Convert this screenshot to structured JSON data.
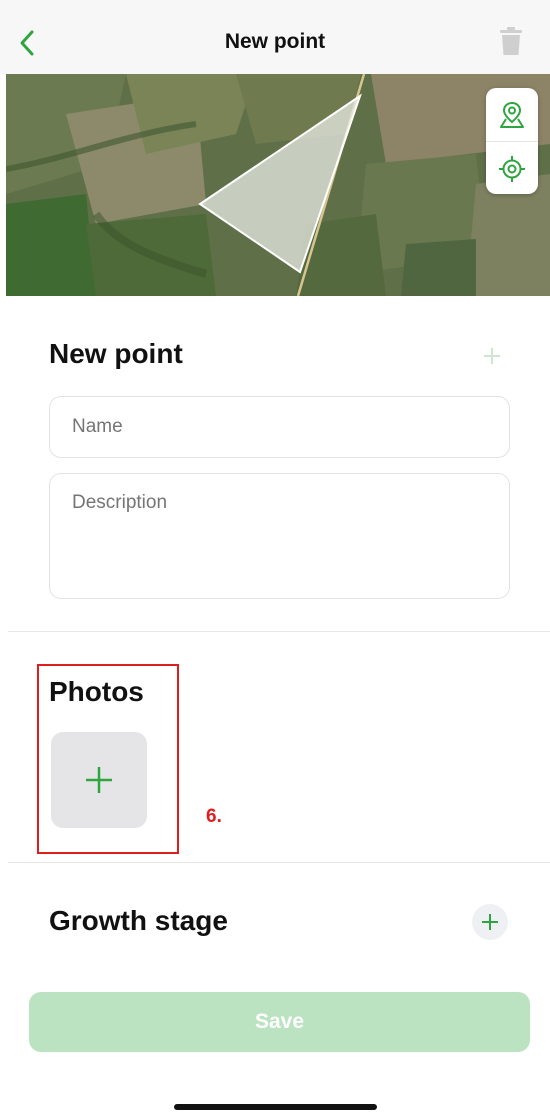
{
  "navbar": {
    "title": "New point",
    "back_icon": "chevron-left-icon",
    "trash_icon": "trash-icon"
  },
  "map": {
    "controls": [
      "map-pin-icon",
      "locate-target-icon"
    ]
  },
  "point": {
    "title": "New point",
    "name_placeholder": "Name",
    "description_placeholder": "Description"
  },
  "photos": {
    "title": "Photos",
    "add_icon": "plus-icon",
    "annotation": "6."
  },
  "growth_stage": {
    "title": "Growth stage"
  },
  "save_label": "Save",
  "colors": {
    "accent": "#2fa53f",
    "save_bg": "#bce3c1",
    "highlight": "#e01e1e"
  }
}
